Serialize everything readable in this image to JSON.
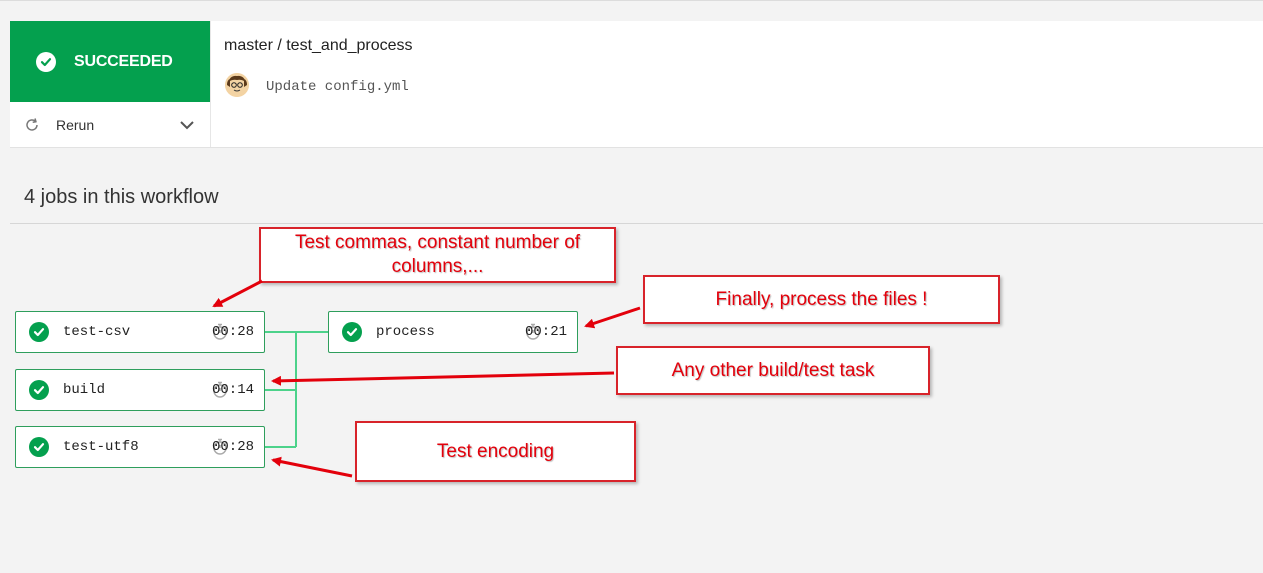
{
  "header": {
    "status_label": "SUCCEEDED",
    "rerun_label": "Rerun",
    "branch_path": "master / test_and_process",
    "commit_message": "Update config.yml"
  },
  "workflow": {
    "title": "4 jobs in this workflow",
    "jobs": [
      {
        "name": "test-csv",
        "duration": "00:28"
      },
      {
        "name": "build",
        "duration": "00:14"
      },
      {
        "name": "test-utf8",
        "duration": "00:28"
      },
      {
        "name": "process",
        "duration": "00:21"
      }
    ]
  },
  "annotations": {
    "test_csv": "Test commas, constant number of columns,...",
    "process": "Finally, process the files !",
    "build": "Any other build/test task",
    "test_utf8": "Test encoding"
  },
  "colors": {
    "success": "#04a04e",
    "job_border": "#2e9e5c",
    "connector": "#4cd28a",
    "annotation": "#e3000b"
  },
  "icons": [
    "check-circle-icon",
    "rerun-icon",
    "chevron-down-icon",
    "stopwatch-icon",
    "avatar"
  ]
}
